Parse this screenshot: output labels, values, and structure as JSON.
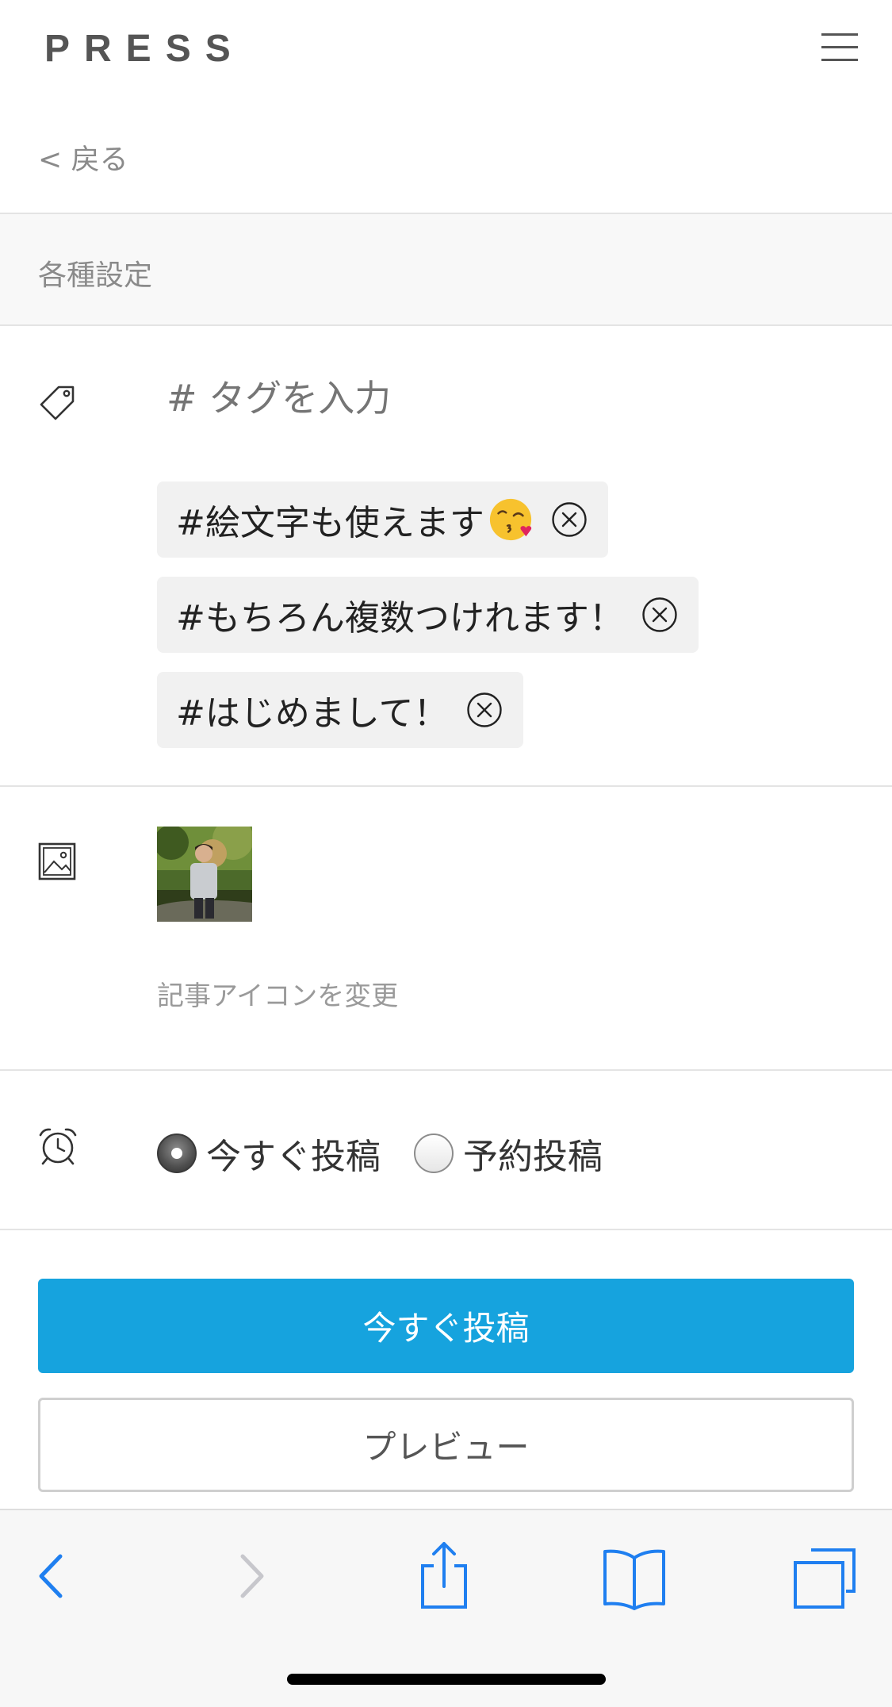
{
  "header": {
    "logo": "PRESS",
    "menu_icon": "hamburger-menu-icon"
  },
  "nav": {
    "back_label": "< 戻る"
  },
  "section": {
    "title": "各種設定"
  },
  "tags": {
    "icon": "tag-icon",
    "input_placeholder": "# タグを入力",
    "items": [
      {
        "label": "#絵文字も使えます",
        "emoji": "kissing-face-with-heart-emoji"
      },
      {
        "label": "#もちろん複数つけれます！"
      },
      {
        "label": "#はじめまして！"
      }
    ],
    "remove_icon": "circle-x-icon"
  },
  "article_icon": {
    "icon": "image-icon",
    "thumbnail": "person-photo-thumbnail",
    "change_label": "記事アイコンを変更"
  },
  "schedule": {
    "icon": "alarm-clock-icon",
    "options": [
      {
        "label": "今すぐ投稿",
        "selected": true
      },
      {
        "label": "予約投稿",
        "selected": false
      }
    ]
  },
  "actions": {
    "primary_label": "今すぐ投稿",
    "secondary_label": "プレビュー"
  },
  "colors": {
    "accent": "#16a3de",
    "safari_blue": "#1f7ff0",
    "muted_text": "#8a8a8a"
  },
  "browser_toolbar": {
    "icons": [
      "back-chevron-icon",
      "forward-chevron-icon",
      "share-icon",
      "bookmarks-icon",
      "tabs-icon"
    ]
  }
}
